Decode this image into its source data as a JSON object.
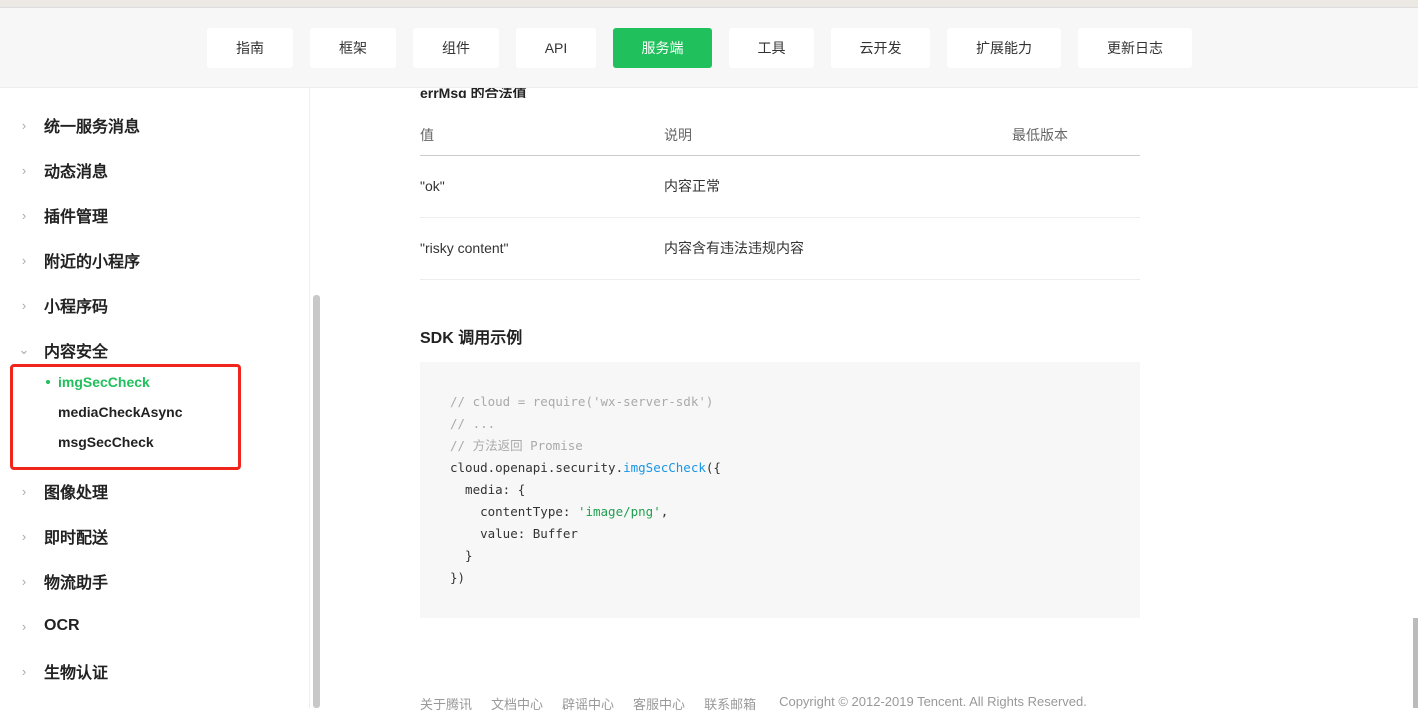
{
  "nav": {
    "items": [
      "指南",
      "框架",
      "组件",
      "API",
      "服务端",
      "工具",
      "云开发",
      "扩展能力",
      "更新日志"
    ],
    "active": "服务端"
  },
  "sidebar": {
    "items": [
      "统一服务消息",
      "动态消息",
      "插件管理",
      "附近的小程序",
      "小程序码",
      "内容安全",
      "图像处理",
      "即时配送",
      "物流助手",
      "OCR",
      "生物认证"
    ],
    "sub_items": [
      "imgSecCheck",
      "mediaCheckAsync",
      "msgSecCheck"
    ]
  },
  "content": {
    "section_title": "errMsg 的合法值",
    "table": {
      "headers": [
        "值",
        "说明",
        "最低版本"
      ],
      "rows": [
        [
          "\"ok\"",
          "内容正常",
          ""
        ],
        [
          "\"risky content\"",
          "内容含有违法违规内容",
          ""
        ]
      ]
    },
    "sdk_title": "SDK 调用示例",
    "code": {
      "l1": "// cloud = require('wx-server-sdk')",
      "l2": "// ...",
      "l3": "// 方法返回 Promise",
      "l4a": "cloud.openapi.security.",
      "l4b": "imgSecCheck",
      "l4c": "({",
      "l5": "  media: {",
      "l6a": "    contentType: ",
      "l6b": "'image/png'",
      "l6c": ",",
      "l7": "    value: Buffer",
      "l8": "  }",
      "l9": "})"
    }
  },
  "footer": {
    "links": [
      "关于腾讯",
      "文档中心",
      "辟谣中心",
      "客服中心",
      "联系邮箱"
    ],
    "copyright": "Copyright © 2012-2019 Tencent. All Rights Reserved."
  },
  "colors": {
    "accent": "#20c05c",
    "highlight_box": "#f0261d"
  }
}
